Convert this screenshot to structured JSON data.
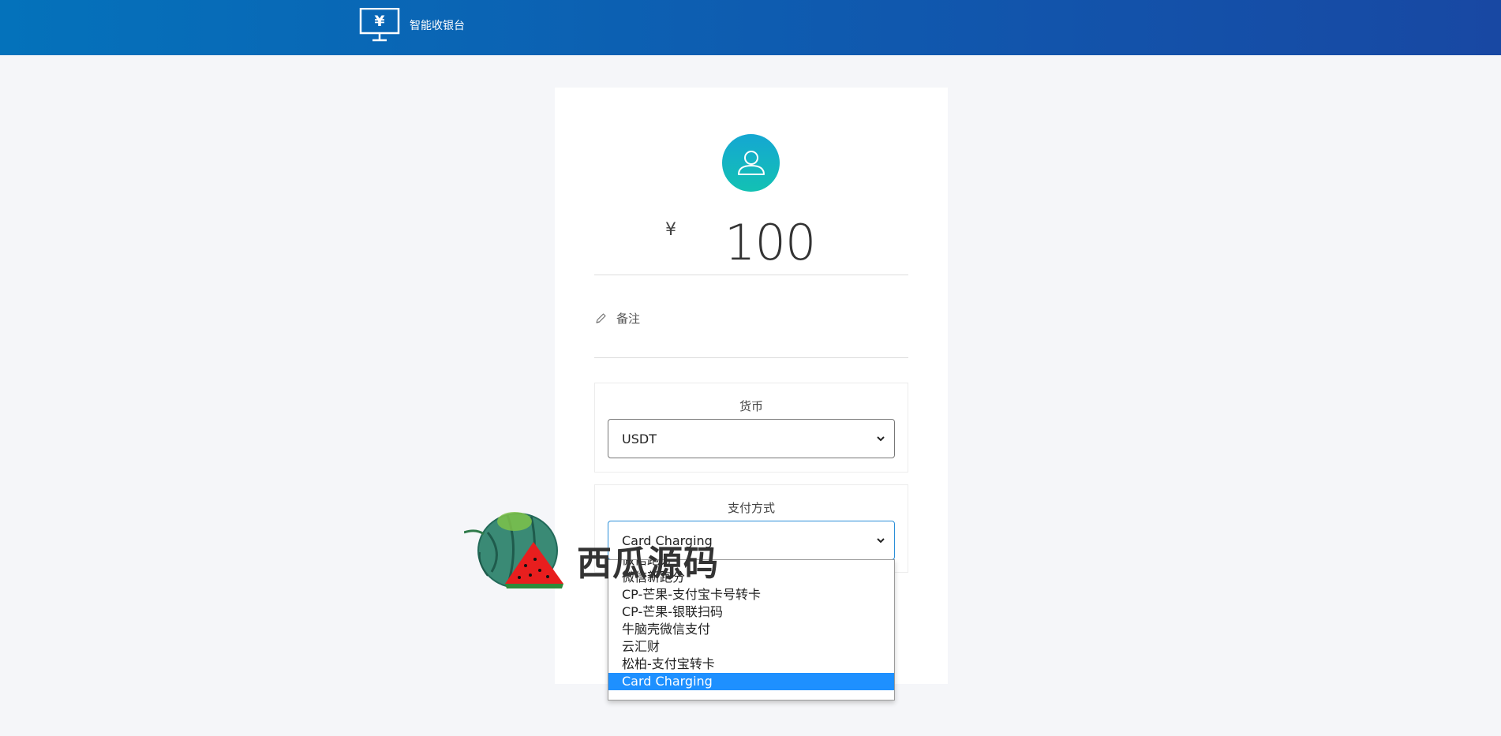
{
  "header": {
    "title": "智能收银台",
    "icon": "monitor-yen-icon",
    "gradient": [
      "#0472bb",
      "#1848a3"
    ]
  },
  "payment": {
    "avatar_icon": "user-icon",
    "currency_symbol": "¥",
    "amount": "100",
    "remark_icon": "pencil-icon",
    "remark_label": "备注"
  },
  "currency_select": {
    "label": "货币",
    "value": "USDT"
  },
  "method_select": {
    "label": "支付方式",
    "value": "Card Charging",
    "options": [
      "微信跑分",
      "微信新跑分",
      "CP-芒果-支付宝卡号转卡",
      "CP-芒果-银联扫码",
      "牛脑壳微信支付",
      "云汇财",
      "松柏-支付宝转卡",
      "Card Charging"
    ],
    "selected_index": 7,
    "highlight_color": "#1e90ff"
  },
  "watermark": {
    "text": "西瓜源码",
    "icon": "watermelon-logo-icon"
  }
}
